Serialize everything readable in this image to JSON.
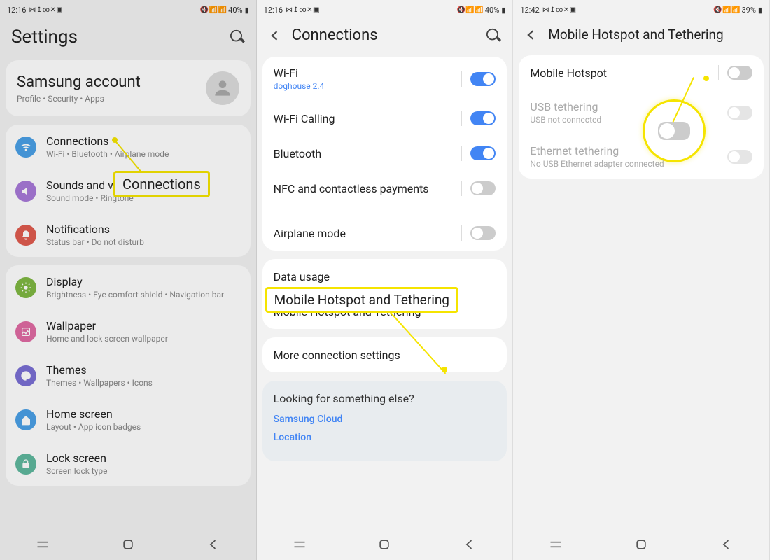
{
  "panels": {
    "left": {
      "status": {
        "time": "12:16",
        "status_icons_left": "⋈ ↥ ∞ ✕ ▣",
        "status_icons_right": "🔇 📶 📶",
        "battery": "40%",
        "battery_icon": "▮"
      },
      "header": {
        "title": "Settings"
      },
      "account": {
        "title": "Samsung account",
        "subtitle": "Profile  •  Security  •  Apps"
      },
      "items": [
        {
          "icon": "wifi",
          "color": "#4aa0e6",
          "title": "Connections",
          "subtitle": "Wi-Fi  •  Bluetooth  •  Airplane mode"
        },
        {
          "icon": "sound",
          "color": "#a779d8",
          "title": "Sounds and vibration",
          "subtitle": "Sound mode  •  Ringtone"
        },
        {
          "icon": "bell",
          "color": "#e05b4e",
          "title": "Notifications",
          "subtitle": "Status bar  •  Do not disturb"
        }
      ],
      "items2": [
        {
          "icon": "sun",
          "color": "#7fb842",
          "title": "Display",
          "subtitle": "Brightness  •  Eye comfort shield  •  Navigation bar"
        },
        {
          "icon": "wallpaper",
          "color": "#e06ba3",
          "title": "Wallpaper",
          "subtitle": "Home and lock screen wallpaper"
        },
        {
          "icon": "themes",
          "color": "#7a6fd4",
          "title": "Themes",
          "subtitle": "Themes  •  Wallpapers  •  Icons"
        },
        {
          "icon": "home",
          "color": "#4aa0e6",
          "title": "Home screen",
          "subtitle": "Layout  •  App icon badges"
        },
        {
          "icon": "lock",
          "color": "#5fb89e",
          "title": "Lock screen",
          "subtitle": "Screen lock type"
        }
      ],
      "callout": "Connections"
    },
    "middle": {
      "status": {
        "time": "12:16",
        "status_icons_left": "⋈ ↥ ∞ ✕ ▣",
        "status_icons_right": "🔇 📶 📶",
        "battery": "40%",
        "battery_icon": "▮"
      },
      "header": {
        "title": "Connections"
      },
      "group1": [
        {
          "title": "Wi-Fi",
          "subtitle": "doghouse 2.4",
          "subtitle_link": true,
          "toggle": true
        },
        {
          "title": "Wi-Fi Calling",
          "toggle": true
        },
        {
          "title": "Bluetooth",
          "toggle": true
        },
        {
          "title": "NFC and contactless payments",
          "toggle": false
        },
        {
          "title": "Airplane mode",
          "toggle": false,
          "gap_above": true
        }
      ],
      "group2": [
        {
          "title": "Data usage"
        },
        {
          "title": "Mobile Hotspot and Tethering"
        }
      ],
      "group3": [
        {
          "title": "More connection settings"
        }
      ],
      "looking": {
        "title": "Looking for something else?",
        "links": [
          "Samsung Cloud",
          "Location"
        ]
      },
      "callout": "Mobile Hotspot and Tethering"
    },
    "right": {
      "status": {
        "time": "12:42",
        "status_icons_left": "⋈ ↥ ∞ ✕ ▣",
        "status_icons_right": "🔇 📶 📶",
        "battery": "39%",
        "battery_icon": "▮"
      },
      "header": {
        "title": "Mobile Hotspot and Tethering"
      },
      "items": [
        {
          "title": "Mobile Hotspot",
          "toggle": false,
          "disabled": false
        },
        {
          "title": "USB tethering",
          "subtitle": "USB not connected",
          "toggle": false,
          "disabled": true
        },
        {
          "title": "Ethernet tethering",
          "subtitle": "No USB Ethernet adapter connected",
          "toggle": false,
          "disabled": true
        }
      ]
    }
  }
}
